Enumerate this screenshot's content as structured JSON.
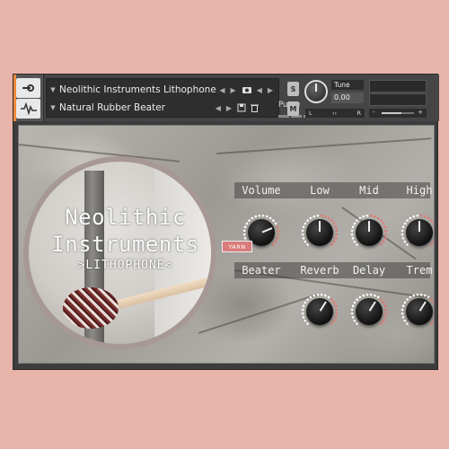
{
  "header": {
    "instrument_name": "Neolithic Instruments Lithophone",
    "preset_name": "Natural Rubber Beater",
    "purge_label": "Purge",
    "solo_label": "S",
    "mute_label": "M",
    "tune_label": "Tune",
    "tune_value": "0.00",
    "pan_left": "L",
    "pan_right": "R",
    "vol_minus": "-",
    "vol_plus": "+",
    "nav_prev": "◀",
    "nav_next": "▶",
    "dropdown_arrow": "▼"
  },
  "logo": {
    "title_line1": "Neolithic",
    "title_line2": "Instruments",
    "subtitle": ">LITHOPHONE<"
  },
  "controls": {
    "row1": [
      {
        "label": "Volume",
        "value": 0.75
      },
      {
        "label": "Low",
        "value": 0.5
      },
      {
        "label": "Mid",
        "value": 0.5
      },
      {
        "label": "High",
        "value": 0.5
      }
    ],
    "row2": [
      {
        "label": "Beater"
      },
      {
        "label": "Reverb",
        "value": 0.62
      },
      {
        "label": "Delay",
        "value": 0.62
      },
      {
        "label": "Trem",
        "value": 0.62
      }
    ],
    "beater_button": "YARN"
  },
  "colors": {
    "background": "#e8b3a9",
    "accent": "#ef8a3c",
    "knob_ring": "#e07a72"
  }
}
